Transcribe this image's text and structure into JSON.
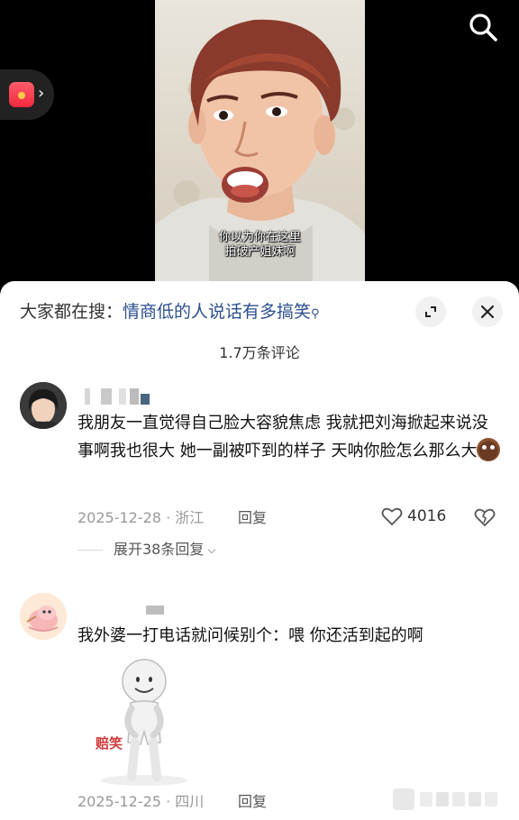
{
  "video": {
    "subtitle_line1": "你以为你在这里",
    "subtitle_line2": "拍破产姐妹啊"
  },
  "sheet": {
    "search_prefix": "大家都在搜：",
    "search_query": "情商低的人说话有多搞笑",
    "comment_count": "1.7万条评论"
  },
  "comments": [
    {
      "text": "我朋友一直觉得自己脸大容貌焦虑 我就把刘海掀起来说没事啊我也很大 她一副被吓到的样子 天呐你脸怎么那么大",
      "date": "2025-12-28",
      "location": "浙江",
      "reply_label": "回复",
      "likes": "4016",
      "expand_label": "展开38条回复"
    },
    {
      "text": "我外婆一打电话就问候别个：喂 你还活到起的啊",
      "sticker_caption": "赔笑",
      "date": "2025-12-25",
      "location": "四川",
      "reply_label": "回复"
    }
  ],
  "meta": {
    "separator": " · "
  },
  "colors": {
    "link_blue": "#2c4f8f",
    "meta_gray": "#999999"
  }
}
